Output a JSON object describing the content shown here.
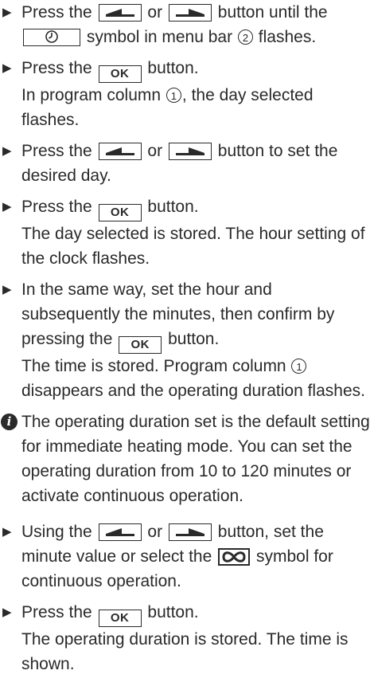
{
  "bullet_glyph": "▶",
  "info_glyph": "i",
  "ok_label": "OK",
  "callout_1": "1",
  "callout_2": "2",
  "steps": {
    "s1": {
      "t1": "Press the",
      "t2": "or",
      "t3": "button until the",
      "t4": "symbol in menu bar",
      "t5": "flashes."
    },
    "s2": {
      "t1": "Press the",
      "t2": "button.",
      "r1": "In program column",
      "r2": ", the day selected flashes."
    },
    "s3": {
      "t1": "Press the",
      "t2": "or",
      "t3": "button to set the desired day."
    },
    "s4": {
      "t1": "Press the",
      "t2": "button.",
      "r1": "The day selected is stored. The hour setting of the clock flashes."
    },
    "s5": {
      "t1": "In the same way, set the hour and subsequently the minutes, then confirm by pressing the",
      "t2": "button.",
      "r1": "The time is stored. Program column",
      "r2": "disappears and the operating duration flashes."
    },
    "note": "The operating duration set is the default setting for immediate heating mode. You can set the operating duration from 10 to 120 minutes or activate continuous operation.",
    "s6": {
      "t1": "Using the",
      "t2": "or",
      "t3": "button, set the minute value or select the",
      "t4": "symbol for continuous operation."
    },
    "s7": {
      "t1": "Press the",
      "t2": "button.",
      "r1": "The operating duration is stored. The time is shown."
    }
  }
}
